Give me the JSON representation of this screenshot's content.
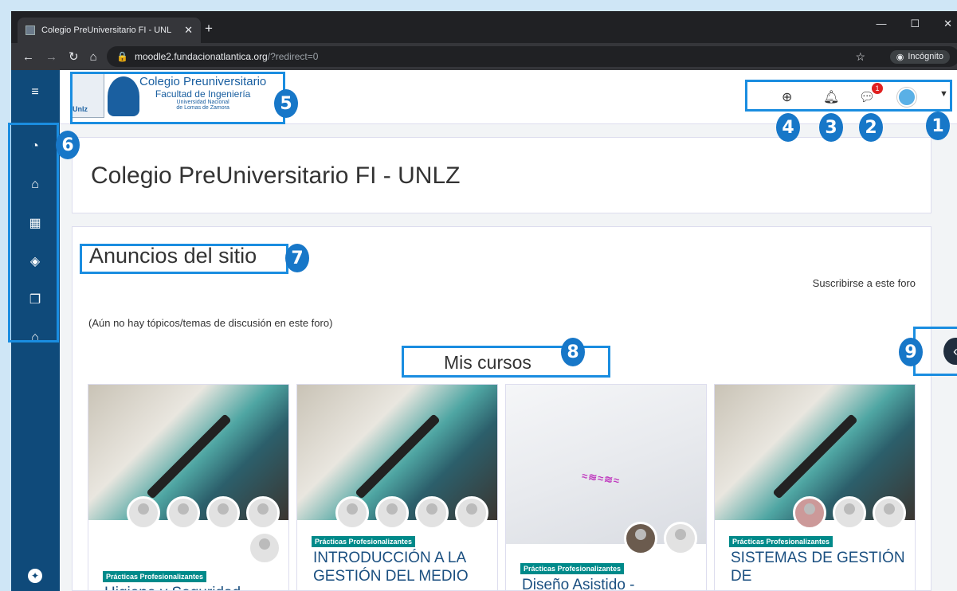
{
  "browser": {
    "tab_title": "Colegio PreUniversitario FI - UNL",
    "url_host": "moodle2.fundacionatlantica.org",
    "url_path": "/?redirect=0",
    "incognito_label": "Incógnito"
  },
  "logo": {
    "line1": "Colegio Preuniversitario",
    "line2": "Facultad de Ingeniería",
    "line3": "Universidad Nacional",
    "line4": "de Lomas de Zamora",
    "mark": "Unlz"
  },
  "header": {
    "message_count": "1"
  },
  "markers": [
    "1",
    "2",
    "3",
    "4",
    "5",
    "6",
    "7",
    "8",
    "9"
  ],
  "page": {
    "title": "Colegio PreUniversitario FI - UNLZ",
    "announcements_heading": "Anuncios del sitio",
    "subscribe_link": "Suscribirse a este foro",
    "no_topics": "(Aún no hay tópicos/temas de discusión en este foro)",
    "my_courses_heading": "Mis cursos"
  },
  "courses": [
    {
      "category": "Prácticas Profesionalizantes",
      "title": "Higiene y Seguridad"
    },
    {
      "category": "Prácticas Profesionalizantes",
      "title": "INTRODUCCIÓN A LA GESTIÓN DEL MEDIO"
    },
    {
      "category": "Prácticas Profesionalizantes",
      "title": "Diseño Asistido -"
    },
    {
      "category": "Prácticas Profesionalizantes",
      "title": "SISTEMAS DE GESTIÓN DE"
    }
  ],
  "colors": {
    "sidebar": "#0f4a7a",
    "accent": "#1777c8",
    "tag": "#008a8a"
  }
}
